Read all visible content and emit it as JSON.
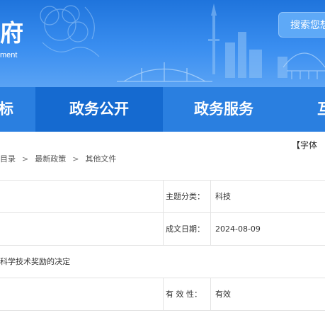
{
  "header": {
    "site_title": "府",
    "site_subtitle": "ment",
    "search_button": "搜索您想"
  },
  "nav": {
    "items": [
      {
        "label": "标"
      },
      {
        "label": "政务公开"
      },
      {
        "label": "政务服务"
      },
      {
        "label": "互"
      }
    ]
  },
  "toolbar": {
    "font_size_label": "【字体"
  },
  "breadcrumb": {
    "items": [
      "目录",
      "最新政策",
      "其他文件"
    ],
    "separator": ">"
  },
  "doc_info": {
    "subject_label": "主题分类：",
    "subject_value": "科技",
    "date_label": "成文日期：",
    "date_value": "2024-08-09",
    "title_fragment": "科学技术奖励的决定",
    "validity_label": "有 效 性：",
    "validity_value": "有效"
  },
  "colors": {
    "banner": "#2a7fe0",
    "nav_active": "#156ad0"
  }
}
